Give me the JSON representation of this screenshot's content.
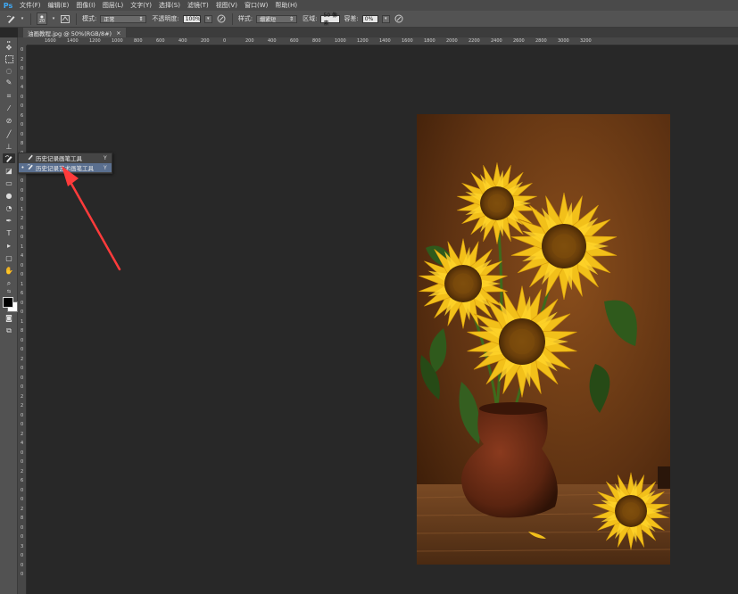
{
  "app": {
    "logo": "Ps"
  },
  "menu": [
    "文件(F)",
    "编辑(E)",
    "图像(I)",
    "图层(L)",
    "文字(Y)",
    "选择(S)",
    "滤镜(T)",
    "视图(V)",
    "窗口(W)",
    "帮助(H)"
  ],
  "options": {
    "brush_size": "20",
    "mode_label": "模式:",
    "mode_value": "正常",
    "opacity_label": "不透明度:",
    "opacity_value": "100%",
    "style_label": "样式:",
    "style_value": "绷紧短",
    "area_label": "区域:",
    "area_value": "50 像素",
    "tolerance_label": "容差:",
    "tolerance_value": "0%"
  },
  "document_tab": {
    "title": "油画教程.jpg @ 50%(RGB/8#)",
    "close": "×"
  },
  "hruler_labels": [
    "1600",
    "1400",
    "1200",
    "1000",
    "800",
    "600",
    "400",
    "200",
    "0",
    "200",
    "400",
    "600",
    "800",
    "1000",
    "1200",
    "1400",
    "1600",
    "1800",
    "2000",
    "2200",
    "2400",
    "2600",
    "2800",
    "3000",
    "3200"
  ],
  "vruler_labels": [
    "0",
    "2",
    "0",
    "0",
    "4",
    "0",
    "0",
    "6",
    "0",
    "0",
    "8",
    "0",
    "0",
    "1",
    "0",
    "0",
    "0",
    "1",
    "2",
    "0",
    "0",
    "1",
    "4",
    "0",
    "0",
    "1",
    "6",
    "0",
    "0",
    "1",
    "8",
    "0",
    "0",
    "2",
    "0",
    "0",
    "0",
    "2",
    "2",
    "0",
    "0",
    "2",
    "4",
    "0",
    "0",
    "2",
    "6",
    "0",
    "0",
    "2",
    "8",
    "0",
    "0",
    "3",
    "0",
    "0",
    "0"
  ],
  "flyout": {
    "items": [
      {
        "label": "历史记录画笔工具",
        "key": "Y",
        "selected": false
      },
      {
        "label": "历史记录艺术画笔工具",
        "key": "Y",
        "selected": true
      }
    ]
  },
  "colors": {
    "accent": "#ff3b3b",
    "selection": "#5a6f8f"
  }
}
